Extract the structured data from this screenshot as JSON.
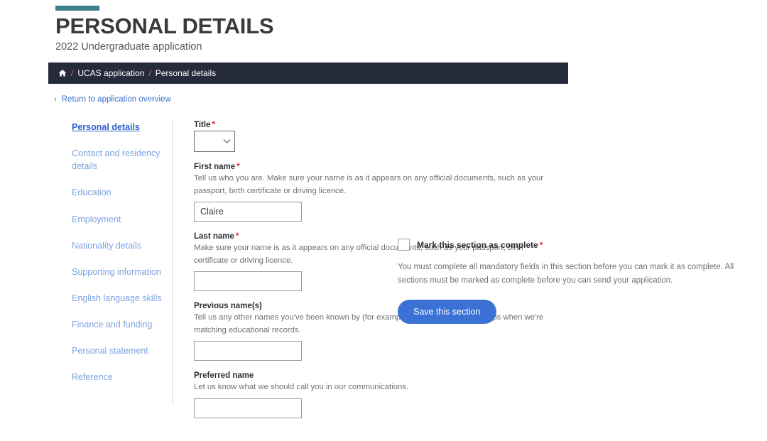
{
  "header": {
    "title": "PERSONAL DETAILS",
    "subtitle": "2022 Undergraduate application",
    "accent_color": "#3d7f8c"
  },
  "breadcrumb": {
    "home_icon": "home-icon",
    "separator": "/",
    "items": [
      {
        "label": "UCAS application"
      },
      {
        "label": "Personal details"
      }
    ],
    "bar_color": "#252b3a",
    "separator_color": "#e8607a"
  },
  "return_link": {
    "chevron": "‹",
    "label": "Return to application overview",
    "color": "#3d6fd0"
  },
  "sidebar": {
    "items": [
      {
        "label": "Personal details",
        "active": true
      },
      {
        "label": "Contact and residency details",
        "active": false
      },
      {
        "label": "Education",
        "active": false
      },
      {
        "label": "Employment",
        "active": false
      },
      {
        "label": "Nationality details",
        "active": false
      },
      {
        "label": "Supporting information",
        "active": false
      },
      {
        "label": "English language skills",
        "active": false
      },
      {
        "label": "Finance and funding",
        "active": false
      },
      {
        "label": "Personal statement",
        "active": false
      },
      {
        "label": "Reference",
        "active": false
      }
    ],
    "link_color": "#7ba3e0",
    "active_color": "#2f63cf"
  },
  "form": {
    "required_marker": "*",
    "title_field": {
      "label": "Title",
      "required": true,
      "value": "",
      "icon": "chevron-down-icon"
    },
    "first_name": {
      "label": "First name",
      "required": true,
      "hint": "Tell us who you are. Make sure your name is as it appears on any official documents, such as your passport, birth certificate or driving licence.",
      "value": "Claire",
      "placeholder": ""
    },
    "last_name": {
      "label": "Last name",
      "required": true,
      "hint": "Make sure your name is as it appears on any official documents, such as your passport, birth certificate or driving licence.",
      "value": "",
      "placeholder": ""
    },
    "previous_names": {
      "label": "Previous name(s)",
      "required": false,
      "hint": "Tell us any other names you've been known by (for example maiden name), as it helps when we're matching educational records.",
      "value": "",
      "placeholder": ""
    },
    "preferred_name": {
      "label": "Preferred name",
      "required": false,
      "hint": "Let us know what we should call you in our communications.",
      "value": "",
      "placeholder": ""
    }
  },
  "completion": {
    "checkbox_label": "Mark this section as complete",
    "checkbox_required": true,
    "checked": false,
    "help_text": "You must complete all mandatory fields in this section before you can mark it as complete. All sections must be marked as complete before you can send your application.",
    "save_button": "Save this section",
    "save_button_color": "#3b71d4"
  }
}
